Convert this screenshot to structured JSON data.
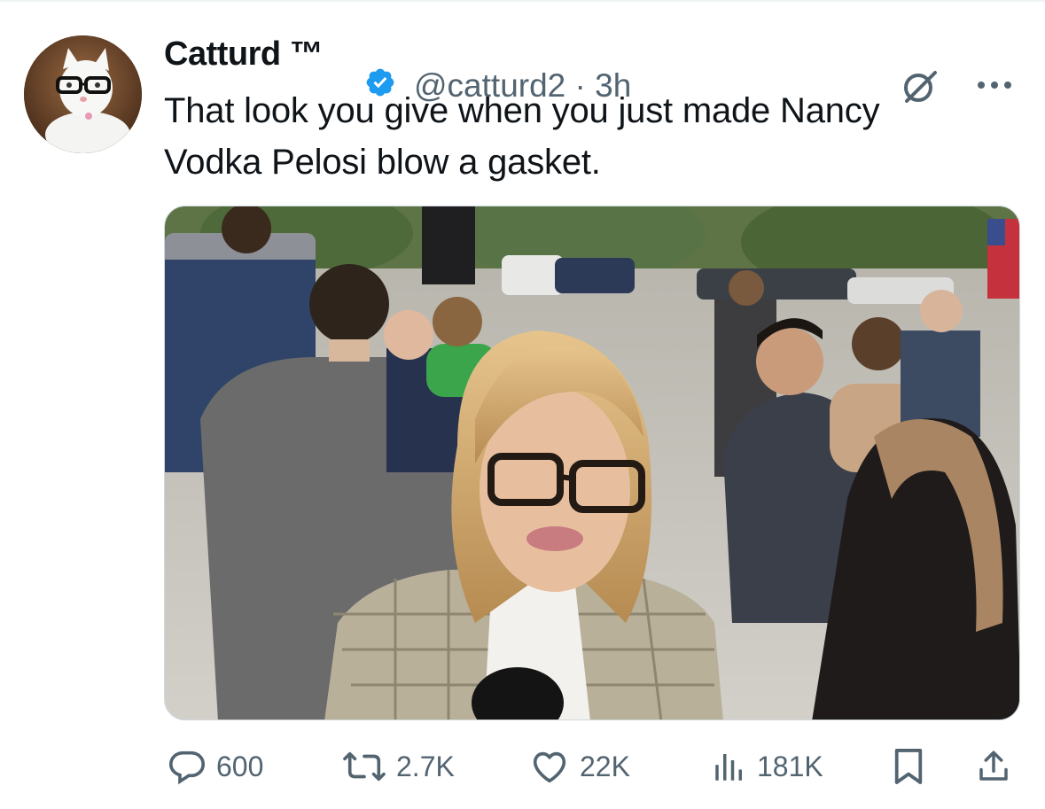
{
  "tweet": {
    "author_name": "Catturd ™",
    "handle_time": "@catturd2 · 3h",
    "text_lines": [
      "That look you give when you just made Nancy",
      "Vodka Pelosi blow a gasket."
    ],
    "media": {
      "description": "Video still: blonde reporter in glasses and plaid blazer holding a microphone outdoors, crowd of press and men in suits behind her"
    }
  },
  "actions": {
    "replies": "600",
    "reposts": "2.7K",
    "likes": "22K",
    "views": "181K"
  },
  "icons": [
    "verified-badge-icon",
    "grok-icon",
    "more-icon",
    "reply-icon",
    "repost-icon",
    "like-icon",
    "views-icon",
    "bookmark-icon",
    "share-icon"
  ],
  "colors": {
    "verified": "#1d9bf0",
    "muted": "#536471",
    "text": "#0f1419"
  }
}
